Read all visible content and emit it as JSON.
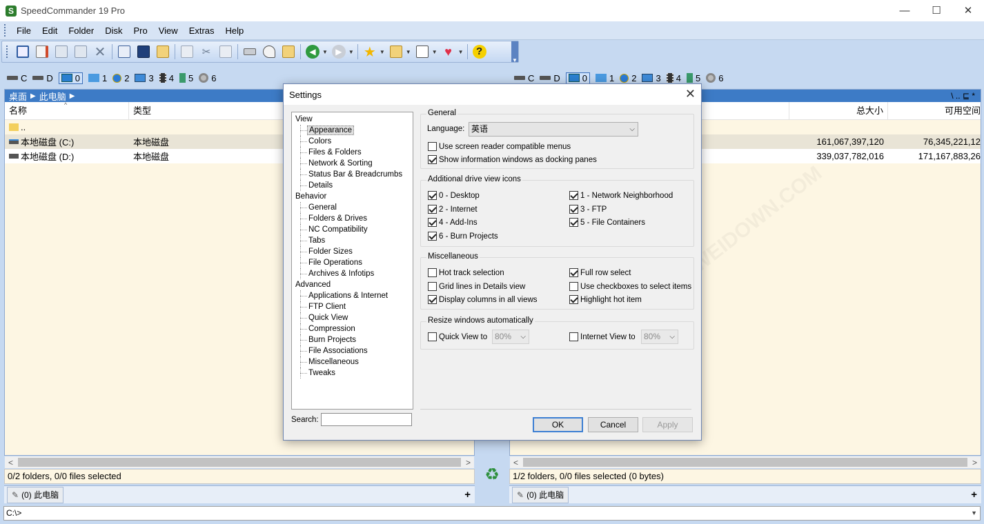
{
  "window": {
    "title": "SpeedCommander 19 Pro",
    "controls": {
      "minimize": "—",
      "maximize": "☐",
      "close": "✕"
    }
  },
  "menu": [
    "File",
    "Edit",
    "Folder",
    "Disk",
    "Pro",
    "View",
    "Extras",
    "Help"
  ],
  "drives": {
    "left": [
      {
        "label": "C",
        "icon": "hdd-icon"
      },
      {
        "label": "D",
        "icon": "hdd-icon"
      },
      {
        "label": "0",
        "icon": "desktop-icon",
        "active": true
      },
      {
        "label": "1",
        "icon": "network-icon"
      },
      {
        "label": "2",
        "icon": "internet-icon"
      },
      {
        "label": "3",
        "icon": "ftp-icon"
      },
      {
        "label": "4",
        "icon": "film-icon"
      },
      {
        "label": "5",
        "icon": "container-icon"
      },
      {
        "label": "6",
        "icon": "disc-icon"
      }
    ],
    "right": [
      {
        "label": "C",
        "icon": "hdd-icon"
      },
      {
        "label": "D",
        "icon": "hdd-icon"
      },
      {
        "label": "0",
        "icon": "desktop-icon",
        "active": true
      },
      {
        "label": "1",
        "icon": "network-icon"
      },
      {
        "label": "2",
        "icon": "internet-icon"
      },
      {
        "label": "3",
        "icon": "ftp-icon"
      },
      {
        "label": "4",
        "icon": "film-icon"
      },
      {
        "label": "5",
        "icon": "container-icon"
      },
      {
        "label": "6",
        "icon": "disc-icon"
      }
    ]
  },
  "left_panel": {
    "breadcrumb": [
      "桌面",
      "此电脑"
    ],
    "columns": [
      "名称",
      "类型"
    ],
    "rows": [
      {
        "name": "..",
        "type": ""
      },
      {
        "name": "本地磁盘 (C:)",
        "type": "本地磁盘"
      },
      {
        "name": "本地磁盘 (D:)",
        "type": "本地磁盘"
      }
    ],
    "status": "0/2 folders, 0/0 files selected",
    "tab": "(0) 此电脑"
  },
  "right_panel": {
    "columns": [
      "总大小",
      "可用空间"
    ],
    "rows": [
      {
        "total": "161,067,397,120",
        "free": "76,345,221,12"
      },
      {
        "total": "339,037,782,016",
        "free": "171,167,883,26"
      }
    ],
    "header_icons": "\\  ..  ⊑  *",
    "status": "1/2 folders, 0/0 files selected (0 bytes)",
    "tab": "(0) 此电脑"
  },
  "cmdline": "C:\\>",
  "dialog": {
    "title": "Settings",
    "tree": [
      {
        "label": "View",
        "level": 0
      },
      {
        "label": "Appearance",
        "level": 1,
        "selected": true
      },
      {
        "label": "Colors",
        "level": 1
      },
      {
        "label": "Files & Folders",
        "level": 1
      },
      {
        "label": "Network & Sorting",
        "level": 1
      },
      {
        "label": "Status Bar & Breadcrumbs",
        "level": 1
      },
      {
        "label": "Details",
        "level": 1
      },
      {
        "label": "Behavior",
        "level": 0
      },
      {
        "label": "General",
        "level": 1
      },
      {
        "label": "Folders & Drives",
        "level": 1
      },
      {
        "label": "NC Compatibility",
        "level": 1
      },
      {
        "label": "Tabs",
        "level": 1
      },
      {
        "label": "Folder Sizes",
        "level": 1
      },
      {
        "label": "File Operations",
        "level": 1
      },
      {
        "label": "Archives & Infotips",
        "level": 1
      },
      {
        "label": "Advanced",
        "level": 0
      },
      {
        "label": "Applications & Internet",
        "level": 1
      },
      {
        "label": "FTP Client",
        "level": 1
      },
      {
        "label": "Quick View",
        "level": 1
      },
      {
        "label": "Compression",
        "level": 1
      },
      {
        "label": "Burn Projects",
        "level": 1
      },
      {
        "label": "File Associations",
        "level": 1
      },
      {
        "label": "Miscellaneous",
        "level": 1
      },
      {
        "label": "Tweaks",
        "level": 1
      }
    ],
    "search_label": "Search:",
    "general": {
      "title": "General",
      "language_label": "Language:",
      "language_value": "英语",
      "screen_reader": {
        "label": "Use screen reader compatible menus",
        "checked": false
      },
      "docking": {
        "label": "Show information windows as docking panes",
        "checked": true
      }
    },
    "drive_icons": {
      "title": "Additional drive view icons",
      "items": [
        {
          "label": "0 - Desktop",
          "checked": true
        },
        {
          "label": "1 - Network Neighborhood",
          "checked": true
        },
        {
          "label": "2 - Internet",
          "checked": true
        },
        {
          "label": "3 - FTP",
          "checked": true
        },
        {
          "label": "4 - Add-Ins",
          "checked": true
        },
        {
          "label": "5 - File Containers",
          "checked": true
        },
        {
          "label": "6 - Burn Projects",
          "checked": true
        }
      ]
    },
    "misc": {
      "title": "Miscellaneous",
      "items": [
        {
          "label": "Hot track selection",
          "checked": false
        },
        {
          "label": "Full row select",
          "checked": true
        },
        {
          "label": "Grid lines in Details view",
          "checked": false
        },
        {
          "label": "Use checkboxes to select items",
          "checked": false
        },
        {
          "label": "Display columns in all views",
          "checked": true
        },
        {
          "label": "Highlight hot item",
          "checked": true
        }
      ]
    },
    "resize": {
      "title": "Resize windows automatically",
      "quick_view": {
        "label": "Quick View to",
        "checked": false,
        "value": "80%"
      },
      "internet_view": {
        "label": "Internet View to",
        "checked": false,
        "value": "80%"
      }
    },
    "buttons": {
      "ok": "OK",
      "cancel": "Cancel",
      "apply": "Apply"
    }
  },
  "watermark": "WWW.WEIDOWN.COM"
}
